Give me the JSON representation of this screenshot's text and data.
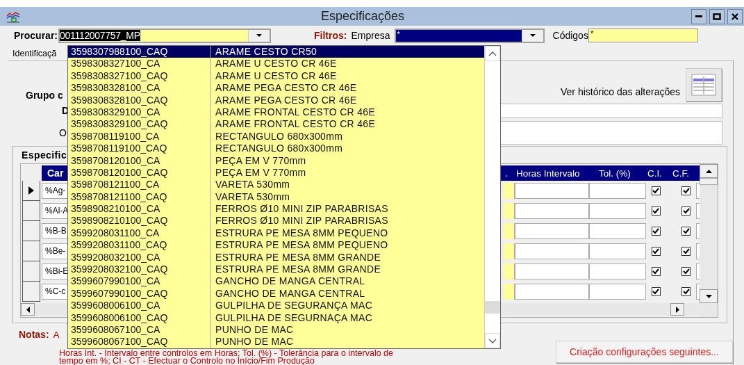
{
  "window": {
    "title": "Especificações"
  },
  "toolbar": {
    "search_label": "Procurar:",
    "search_value": "001112007757_MP",
    "filters_label": "Filtros:",
    "company_label": "Empresa",
    "company_value": "*",
    "codes_label": "Códigos",
    "codes_value": "*"
  },
  "tab": {
    "label": "Identificaçã"
  },
  "form": {
    "group_label": "Grupo c",
    "field_label_1": "D",
    "field_label_2": "O",
    "history_label": "Ver histórico das alterações"
  },
  "specs": {
    "title": "Especific",
    "code_header": "Car",
    "fragment_header": ".",
    "right_headers": [
      "Horas Intervalo",
      "Tol. (%)",
      "C.I.",
      "C.F."
    ],
    "rows": [
      {
        "code": "%Ag-",
        "current": true,
        "ci": true,
        "cf": true
      },
      {
        "code": "%Al-A",
        "current": false,
        "ci": true,
        "cf": true
      },
      {
        "code": "%B-B",
        "current": false,
        "ci": true,
        "cf": true
      },
      {
        "code": "%Be-",
        "current": false,
        "ci": true,
        "cf": true
      },
      {
        "code": "%Bi-E",
        "current": false,
        "ci": true,
        "cf": true
      },
      {
        "code": "%C-c",
        "current": false,
        "ci": true,
        "cf": true
      }
    ]
  },
  "notes": {
    "label": "Notas:",
    "first": "A",
    "lines": [
      "Horas Int. - Intervalo entre controlos em Horas; Tol. (%) - Tolerância para o intervalo de",
      "tempo em %; CI - CT - Efectuar o Controlo no Início/Fim Produção"
    ]
  },
  "next_button": "Criação configurações seguintes...",
  "dropdown": [
    {
      "code": "3598307988100_CAQ",
      "name": "ARAME CESTO CR50",
      "selected": true
    },
    {
      "code": "3598308327100_CA",
      "name": "ARAME U CESTO CR 46E",
      "selected": false
    },
    {
      "code": "3598308327100_CAQ",
      "name": "ARAME U CESTO CR 46E",
      "selected": false
    },
    {
      "code": "3598308328100_CA",
      "name": "ARAME PEGA CESTO CR 46E",
      "selected": false
    },
    {
      "code": "3598308328100_CAQ",
      "name": "ARAME PEGA CESTO CR 46E",
      "selected": false
    },
    {
      "code": "3598308329100_CA",
      "name": "ARAME FRONTAL CESTO CR 46E",
      "selected": false
    },
    {
      "code": "3598308329100_CAQ",
      "name": "ARAME FRONTAL CESTO CR 46E",
      "selected": false
    },
    {
      "code": "3598708119100_CA",
      "name": "RECTANGULO 680x300mm",
      "selected": false
    },
    {
      "code": "3598708119100_CAQ",
      "name": "RECTANGULO 680x300mm",
      "selected": false
    },
    {
      "code": "3598708120100_CA",
      "name": "PEÇA EM V 770mm",
      "selected": false
    },
    {
      "code": "3598708120100_CAQ",
      "name": "PEÇA EM V 770mm",
      "selected": false
    },
    {
      "code": "3598708121100_CA",
      "name": "VARETA 530mm",
      "selected": false
    },
    {
      "code": "3598708121100_CAQ",
      "name": "VARETA 530mm",
      "selected": false
    },
    {
      "code": "3598908210100_CA",
      "name": "FERROS Ø10 MINI ZIP PARABRISAS",
      "selected": false
    },
    {
      "code": "3598908210100_CAQ",
      "name": "FERROS Ø10 MINI ZIP PARABRISAS",
      "selected": false
    },
    {
      "code": "3599208031100_CA",
      "name": "ESTRURA PE MESA 8MM PEQUENO",
      "selected": false
    },
    {
      "code": "3599208031100_CAQ",
      "name": "ESTRURA PE MESA 8MM PEQUENO",
      "selected": false
    },
    {
      "code": "3599208032100_CA",
      "name": "ESTRURA PE MESA 8MM GRANDE",
      "selected": false
    },
    {
      "code": "3599208032100_CAQ",
      "name": "ESTRURA PE MESA 8MM GRANDE",
      "selected": false
    },
    {
      "code": "3599607990100_CA",
      "name": "GANCHO DE MANGA CENTRAL",
      "selected": false
    },
    {
      "code": "3599607990100_CAQ",
      "name": "GANCHO DE MANGA CENTRAL",
      "selected": false
    },
    {
      "code": "3599608006100_CA",
      "name": "GULPILHA DE SEGURANÇA MAC",
      "selected": false
    },
    {
      "code": "3599608006100_CAQ",
      "name": "GULPILHA DE SEGURNAÇA MAC",
      "selected": false
    },
    {
      "code": "3599608067100_CA",
      "name": "PUNHO DE MAC",
      "selected": false
    },
    {
      "code": "3599608067100_CAQ",
      "name": "PUNHO DE MAC",
      "selected": false
    }
  ]
}
